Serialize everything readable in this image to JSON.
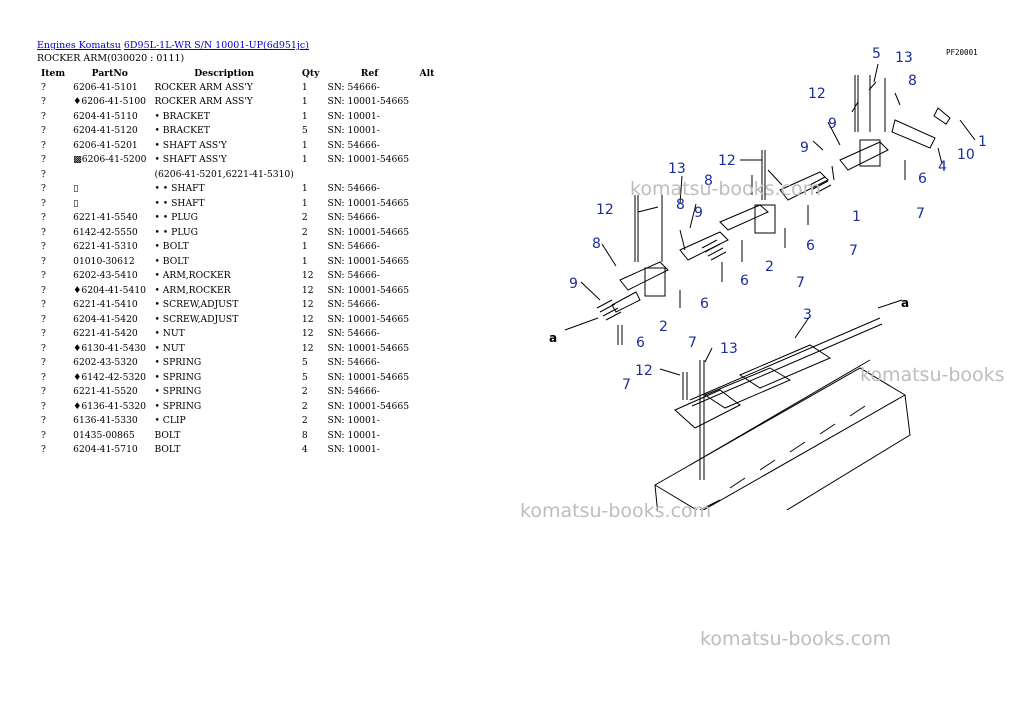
{
  "breadcrumb": {
    "link1": "Engines Komatsu",
    "link2": "6D95L-1L-WR S/N 10001-UP(6d951jc)"
  },
  "subtitle": "ROCKER ARM(030020 : 0111)",
  "columns": [
    "Item",
    "PartNo",
    "Description",
    "Qty",
    "Ref",
    "Alt"
  ],
  "rows": [
    {
      "item": "?",
      "part": "6206-41-5101",
      "desc": "ROCKER ARM ASS'Y",
      "qty": "1",
      "ref": "SN: 54666-"
    },
    {
      "item": "?",
      "part": "♦6206-41-5100",
      "desc": "ROCKER ARM ASS'Y",
      "qty": "1",
      "ref": "SN: 10001-54665"
    },
    {
      "item": "?",
      "part": "6204-41-5110",
      "desc": "• BRACKET",
      "qty": "1",
      "ref": "SN: 10001-"
    },
    {
      "item": "?",
      "part": "6204-41-5120",
      "desc": "• BRACKET",
      "qty": "5",
      "ref": "SN: 10001-"
    },
    {
      "item": "?",
      "part": "6206-41-5201",
      "desc": "• SHAFT ASS'Y",
      "qty": "1",
      "ref": "SN: 54666-"
    },
    {
      "item": "?",
      "part": "▩6206-41-5200",
      "desc": "• SHAFT ASS'Y",
      "qty": "1",
      "ref": "SN: 10001-54665"
    },
    {
      "item": "?",
      "part": "",
      "desc": "(6206-41-5201,6221-41-5310)",
      "qty": "",
      "ref": ""
    },
    {
      "item": "?",
      "part": "▯",
      "desc": "• • SHAFT",
      "qty": "1",
      "ref": "SN: 54666-"
    },
    {
      "item": "?",
      "part": "▯",
      "desc": "• • SHAFT",
      "qty": "1",
      "ref": "SN: 10001-54665"
    },
    {
      "item": "?",
      "part": "6221-41-5540",
      "desc": "• • PLUG",
      "qty": "2",
      "ref": "SN: 54666-"
    },
    {
      "item": "?",
      "part": "6142-42-5550",
      "desc": "• • PLUG",
      "qty": "2",
      "ref": "SN: 10001-54665"
    },
    {
      "item": "?",
      "part": "6221-41-5310",
      "desc": "• BOLT",
      "qty": "1",
      "ref": "SN: 54666-"
    },
    {
      "item": "?",
      "part": "01010-30612",
      "desc": "• BOLT",
      "qty": "1",
      "ref": "SN: 10001-54665"
    },
    {
      "item": "?",
      "part": "6202-43-5410",
      "desc": "• ARM,ROCKER",
      "qty": "12",
      "ref": "SN: 54666-"
    },
    {
      "item": "?",
      "part": "♦6204-41-5410",
      "desc": "• ARM,ROCKER",
      "qty": "12",
      "ref": "SN: 10001-54665"
    },
    {
      "item": "?",
      "part": "6221-41-5410",
      "desc": "• SCREW,ADJUST",
      "qty": "12",
      "ref": "SN: 54666-"
    },
    {
      "item": "?",
      "part": "6204-41-5420",
      "desc": "• SCREW,ADJUST",
      "qty": "12",
      "ref": "SN: 10001-54665"
    },
    {
      "item": "?",
      "part": "6221-41-5420",
      "desc": "• NUT",
      "qty": "12",
      "ref": "SN: 54666-"
    },
    {
      "item": "?",
      "part": "♦6130-41-5430",
      "desc": "• NUT",
      "qty": "12",
      "ref": "SN: 10001-54665"
    },
    {
      "item": "?",
      "part": "6202-43-5320",
      "desc": "• SPRING",
      "qty": "5",
      "ref": "SN: 54666-"
    },
    {
      "item": "?",
      "part": "♦6142-42-5320",
      "desc": "• SPRING",
      "qty": "5",
      "ref": "SN: 10001-54665"
    },
    {
      "item": "?",
      "part": "6221-41-5520",
      "desc": "• SPRING",
      "qty": "2",
      "ref": "SN: 54666-"
    },
    {
      "item": "?",
      "part": "♦6136-41-5320",
      "desc": "• SPRING",
      "qty": "2",
      "ref": "SN: 10001-54665"
    },
    {
      "item": "?",
      "part": "6136-41-5330",
      "desc": "• CLIP",
      "qty": "2",
      "ref": "SN: 10001-"
    },
    {
      "item": "?",
      "part": "01435-00865",
      "desc": "BOLT",
      "qty": "8",
      "ref": "SN: 10001-"
    },
    {
      "item": "?",
      "part": "6204-41-5710",
      "desc": "BOLT",
      "qty": "4",
      "ref": "SN: 10001-"
    }
  ],
  "diagram": {
    "code": "PF20001",
    "callouts": [
      "5",
      "13",
      "12",
      "8",
      "1",
      "10",
      "4",
      "9",
      "6",
      "7",
      "12",
      "8",
      "9",
      "6",
      "1",
      "13",
      "7",
      "12",
      "8",
      "9",
      "2",
      "6",
      "7",
      "8",
      "9",
      "6",
      "2",
      "7",
      "3",
      "a",
      "a",
      "12",
      "13",
      "6",
      "7"
    ],
    "label_color": "#1a2e9a"
  },
  "watermarks": [
    "komatsu-books.com",
    "komatsu-books",
    "komatsu-books.com",
    "komatsu-books.com"
  ]
}
